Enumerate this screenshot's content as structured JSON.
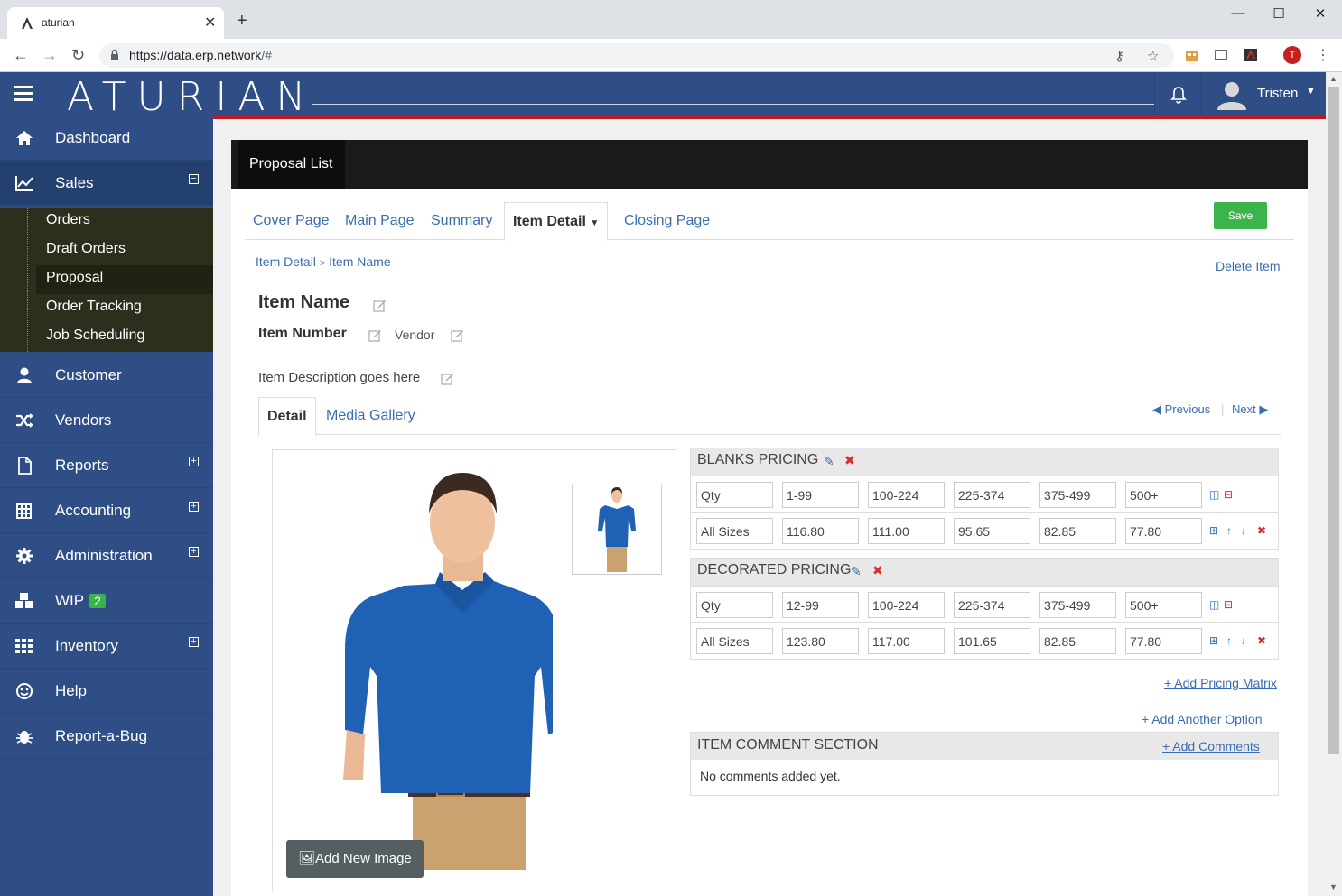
{
  "browser": {
    "tab_title": "aturian",
    "url_host": "https://data.erp.network",
    "url_path": "/#",
    "profile_initial": "T"
  },
  "header": {
    "logo_text": "ATURIAN",
    "user_name": "Tristen"
  },
  "sidebar": {
    "items": [
      {
        "label": "Dashboard",
        "icon": "home-icon"
      },
      {
        "label": "Sales",
        "icon": "chart-line-icon"
      },
      {
        "label": "Customer",
        "icon": "user-icon"
      },
      {
        "label": "Vendors",
        "icon": "shuffle-icon"
      },
      {
        "label": "Reports",
        "icon": "file-icon"
      },
      {
        "label": "Accounting",
        "icon": "calculator-icon"
      },
      {
        "label": "Administration",
        "icon": "gear-icon"
      },
      {
        "label": "WIP",
        "icon": "cubes-icon",
        "badge": "2"
      },
      {
        "label": "Inventory",
        "icon": "grid-icon"
      },
      {
        "label": "Help",
        "icon": "smile-icon"
      },
      {
        "label": "Report-a-Bug",
        "icon": "bug-icon"
      }
    ],
    "sales_sub": [
      "Orders",
      "Draft Orders",
      "Proposal",
      "Order Tracking",
      "Job Scheduling"
    ]
  },
  "page": {
    "card_title": "Proposal List",
    "tabs": [
      "Cover Page",
      "Main Page",
      "Summary",
      "Item Detail",
      "Closing Page"
    ],
    "save_label": "Save",
    "breadcrumb": [
      "Item Detail",
      ">",
      "Item Name"
    ],
    "delete_item": "Delete Item",
    "item_name": "Item Name",
    "item_number": "Item Number",
    "vendor": "Vendor",
    "item_description": "Item Description goes here",
    "detail_tabs": [
      "Detail",
      "Media Gallery"
    ],
    "previous": "Previous",
    "next": "Next",
    "add_new_image": "Add New Image"
  },
  "pricing": {
    "blanks": {
      "title": "BLANKS PRICING",
      "qty_row": [
        "Qty",
        "1-99",
        "100-224",
        "225-374",
        "375-499",
        "500+"
      ],
      "price_row": [
        "All Sizes",
        "116.80",
        "111.00",
        "95.65",
        "82.85",
        "77.80"
      ]
    },
    "decorated": {
      "title": "DECORATED PRICING",
      "qty_row": [
        "Qty",
        "12-99",
        "100-224",
        "225-374",
        "375-499",
        "500+"
      ],
      "price_row": [
        "All Sizes",
        "123.80",
        "117.00",
        "101.65",
        "82.85",
        "77.80"
      ]
    },
    "add_pricing_matrix": "+ Add Pricing Matrix",
    "add_another_option": "+ Add Another Option"
  },
  "comments": {
    "title": "ITEM COMMENT SECTION",
    "add_label": "+ Add Comments",
    "empty_text": "No comments added yet."
  },
  "colors": {
    "header_blue": "#2f4e85",
    "accent_red": "#c4161c",
    "save_green": "#3cb44b",
    "link_blue": "#3a6db0"
  }
}
